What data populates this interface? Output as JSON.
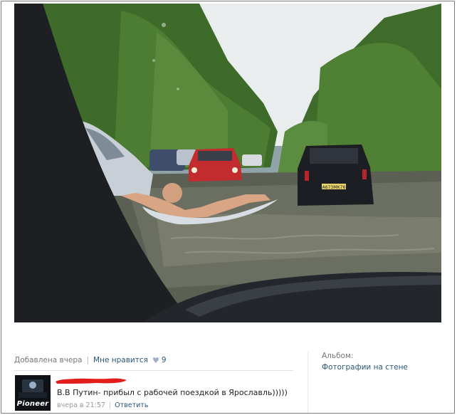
{
  "post": {
    "added_label": "Добавлена вчера",
    "like_label": "Мне нравится",
    "like_icon": "heart-icon",
    "like_count": "9"
  },
  "album": {
    "label": "Альбом:",
    "link": "Фотографии на стене"
  },
  "comment": {
    "avatar_logo": "Pioneer",
    "text": "В.В Путин- прибыл с рабочей поездкой в Ярославль)))))",
    "time": "вчера в 21:57",
    "reply_label": "Ответить"
  },
  "photo": {
    "plate_right": "А673МК76"
  }
}
